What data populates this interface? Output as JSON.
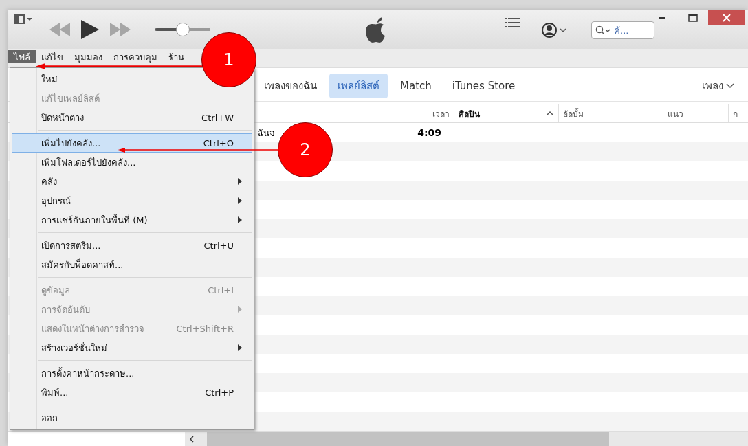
{
  "toolbar": {
    "volume": {
      "level": 0.5
    },
    "search": {
      "placeholder": "ค้..."
    }
  },
  "menubar": [
    {
      "label": "ไฟล์",
      "selected": true
    },
    {
      "label": "แก้ไข",
      "selected": false
    },
    {
      "label": "มุมมอง",
      "selected": false
    },
    {
      "label": "การควบคุม",
      "selected": false
    },
    {
      "label": "ร้าน",
      "selected": false
    }
  ],
  "file_menu": [
    {
      "kind": "item",
      "label": "ใหม่",
      "disabled": false,
      "selected": false
    },
    {
      "kind": "item",
      "label": "แก้ไขเพลย์ลิสต์",
      "disabled": true,
      "selected": false
    },
    {
      "kind": "item",
      "label": "ปิดหน้าต่าง",
      "shortcut": "Ctrl+W",
      "disabled": false,
      "selected": false
    },
    {
      "kind": "separator"
    },
    {
      "kind": "item",
      "label": "เพิ่มไปยังคลัง...",
      "shortcut": "Ctrl+O",
      "disabled": false,
      "selected": true
    },
    {
      "kind": "item",
      "label": "เพิ่มโฟลเดอร์ไปยังคลัง...",
      "disabled": false,
      "selected": false
    },
    {
      "kind": "submenu",
      "label": "คลัง",
      "disabled": false,
      "selected": false
    },
    {
      "kind": "submenu",
      "label": "อุปกรณ์",
      "disabled": false,
      "selected": false
    },
    {
      "kind": "submenu",
      "label": "การแชร์กันภายในพื้นที่  (M)",
      "disabled": false,
      "selected": false
    },
    {
      "kind": "separator"
    },
    {
      "kind": "item",
      "label": "เปิดการสตรีม...",
      "shortcut": "Ctrl+U",
      "disabled": false,
      "selected": false
    },
    {
      "kind": "item",
      "label": "สมัครกับพ็อดคาสท์...",
      "disabled": false,
      "selected": false
    },
    {
      "kind": "separator"
    },
    {
      "kind": "item",
      "label": "ดูข้อมูล",
      "shortcut": "Ctrl+I",
      "disabled": true,
      "selected": false
    },
    {
      "kind": "submenu",
      "label": "การจัดอันดับ",
      "disabled": true,
      "selected": false
    },
    {
      "kind": "item",
      "label": "แสดงในหน้าต่างการสำรวจ",
      "shortcut": "Ctrl+Shift+R",
      "disabled": true,
      "selected": false
    },
    {
      "kind": "submenu",
      "label": "สร้างเวอร์ชั่นใหม่",
      "disabled": false,
      "selected": false
    },
    {
      "kind": "separator"
    },
    {
      "kind": "item",
      "label": "การตั้งค่าหน้ากระดาษ...",
      "disabled": false,
      "selected": false
    },
    {
      "kind": "item",
      "label": "พิมพ์...",
      "shortcut": "Ctrl+P",
      "disabled": false,
      "selected": false
    },
    {
      "kind": "separator"
    },
    {
      "kind": "item",
      "label": "ออก",
      "disabled": false,
      "selected": false
    }
  ],
  "tabs": [
    {
      "label": "เพลงของฉัน",
      "selected": false
    },
    {
      "label": "เพลย์ลิสต์",
      "selected": true
    },
    {
      "label": "Match",
      "selected": false
    },
    {
      "label": "iTunes Store",
      "selected": false
    }
  ],
  "view_menu": {
    "label": "เพลง"
  },
  "table": {
    "columns": [
      {
        "label": "เวลา",
        "sorted": false
      },
      {
        "label": "ศิลปิน",
        "sorted": true
      },
      {
        "label": "อัลบั้ม",
        "sorted": false
      },
      {
        "label": "แนว",
        "sorted": false
      },
      {
        "label": "ก",
        "sorted": false
      }
    ],
    "rows": [
      {
        "title": "ฉันจ",
        "time": "4:09"
      }
    ]
  },
  "annotations": [
    {
      "number": "1"
    },
    {
      "number": "2"
    }
  ]
}
